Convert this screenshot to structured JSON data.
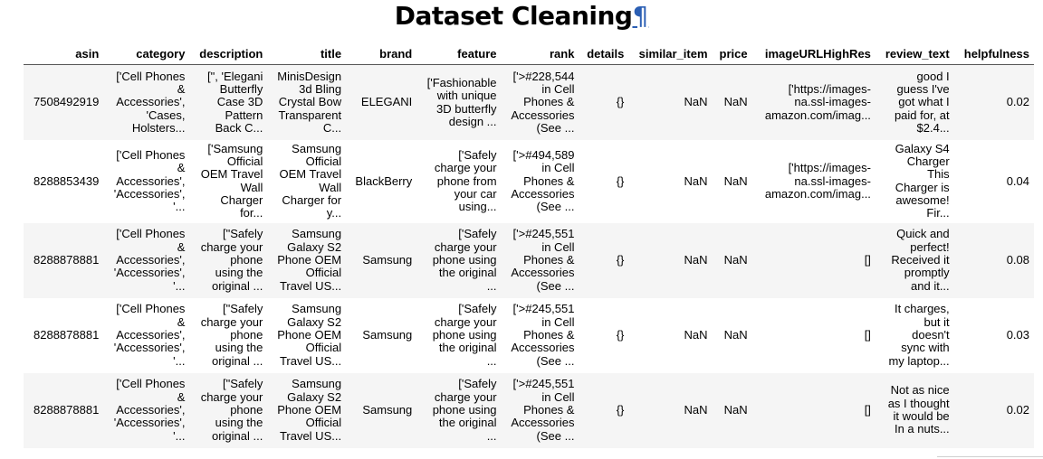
{
  "heading": {
    "title": "Dataset Cleaning",
    "pilcrow": "¶"
  },
  "table": {
    "columns": [
      "asin",
      "category",
      "description",
      "title",
      "brand",
      "feature",
      "rank",
      "details",
      "similar_item",
      "price",
      "imageURLHighRes",
      "review_text",
      "helpfulness"
    ],
    "rows": [
      {
        "asin": "7508492919",
        "category": [
          "['Cell Phones",
          "&",
          "Accessories',",
          "'Cases,",
          "Holsters..."
        ],
        "description": [
          "[\", 'Elegani",
          "Butterfly",
          "Case 3D",
          "Pattern",
          "Back C..."
        ],
        "title": [
          "MinisDesign",
          "3d Bling",
          "Crystal Bow",
          "Transparent",
          "C..."
        ],
        "brand": [
          "ELEGANI"
        ],
        "feature": [
          "['Fashionable",
          "with unique",
          "3D butterfly",
          "design ..."
        ],
        "rank": [
          "['>#228,544",
          "in Cell",
          "Phones &",
          "Accessories",
          "(See ..."
        ],
        "details": [
          "{}"
        ],
        "similar_item": [
          "NaN"
        ],
        "price": [
          "NaN"
        ],
        "imageURLHighRes": [
          "['https://images-",
          "na.ssl-images-",
          "amazon.com/imag..."
        ],
        "review_text": [
          "good I",
          "guess I've",
          "got what I",
          "paid for, at",
          "$2.4..."
        ],
        "helpfulness": [
          "0.02"
        ]
      },
      {
        "asin": "8288853439",
        "category": [
          "['Cell Phones",
          "&",
          "Accessories',",
          "'Accessories',",
          "'..."
        ],
        "description": [
          "['Samsung",
          "Official",
          "OEM Travel",
          "Wall",
          "Charger",
          "for..."
        ],
        "title": [
          "Samsung",
          "Official",
          "OEM Travel",
          "Wall",
          "Charger for",
          "y..."
        ],
        "brand": [
          "BlackBerry"
        ],
        "feature": [
          "['Safely",
          "charge your",
          "phone from",
          "your car",
          "using..."
        ],
        "rank": [
          "['>#494,589",
          "in Cell",
          "Phones &",
          "Accessories",
          "(See ..."
        ],
        "details": [
          "{}"
        ],
        "similar_item": [
          "NaN"
        ],
        "price": [
          "NaN"
        ],
        "imageURLHighRes": [
          "['https://images-",
          "na.ssl-images-",
          "amazon.com/imag..."
        ],
        "review_text": [
          "Galaxy S4",
          "Charger",
          "This",
          "Charger is",
          "awesome!",
          "Fir..."
        ],
        "helpfulness": [
          "0.04"
        ]
      },
      {
        "asin": "8288878881",
        "category": [
          "['Cell Phones",
          "&",
          "Accessories',",
          "'Accessories',",
          "'..."
        ],
        "description": [
          "[\"Safely",
          "charge your",
          "phone",
          "using the",
          "original ..."
        ],
        "title": [
          "Samsung",
          "Galaxy S2",
          "Phone OEM",
          "Official",
          "Travel US..."
        ],
        "brand": [
          "Samsung"
        ],
        "feature": [
          "['Safely",
          "charge your",
          "phone using",
          "the original",
          "..."
        ],
        "rank": [
          "['>#245,551",
          "in Cell",
          "Phones &",
          "Accessories",
          "(See ..."
        ],
        "details": [
          "{}"
        ],
        "similar_item": [
          "NaN"
        ],
        "price": [
          "NaN"
        ],
        "imageURLHighRes": [
          "[]"
        ],
        "review_text": [
          "Quick and",
          "perfect!",
          "Received it",
          "promptly",
          "and it..."
        ],
        "helpfulness": [
          "0.08"
        ]
      },
      {
        "asin": "8288878881",
        "category": [
          "['Cell Phones",
          "&",
          "Accessories',",
          "'Accessories',",
          "'..."
        ],
        "description": [
          "[\"Safely",
          "charge your",
          "phone",
          "using the",
          "original ..."
        ],
        "title": [
          "Samsung",
          "Galaxy S2",
          "Phone OEM",
          "Official",
          "Travel US..."
        ],
        "brand": [
          "Samsung"
        ],
        "feature": [
          "['Safely",
          "charge your",
          "phone using",
          "the original",
          "..."
        ],
        "rank": [
          "['>#245,551",
          "in Cell",
          "Phones &",
          "Accessories",
          "(See ..."
        ],
        "details": [
          "{}"
        ],
        "similar_item": [
          "NaN"
        ],
        "price": [
          "NaN"
        ],
        "imageURLHighRes": [
          "[]"
        ],
        "review_text": [
          "It charges,",
          "but it",
          "doesn't",
          "sync with",
          "my laptop..."
        ],
        "helpfulness": [
          "0.03"
        ]
      },
      {
        "asin": "8288878881",
        "category": [
          "['Cell Phones",
          "&",
          "Accessories',",
          "'Accessories',",
          "'..."
        ],
        "description": [
          "[\"Safely",
          "charge your",
          "phone",
          "using the",
          "original ..."
        ],
        "title": [
          "Samsung",
          "Galaxy S2",
          "Phone OEM",
          "Official",
          "Travel US..."
        ],
        "brand": [
          "Samsung"
        ],
        "feature": [
          "['Safely",
          "charge your",
          "phone using",
          "the original",
          "..."
        ],
        "rank": [
          "['>#245,551",
          "in Cell",
          "Phones &",
          "Accessories",
          "(See ..."
        ],
        "details": [
          "{}"
        ],
        "similar_item": [
          "NaN"
        ],
        "price": [
          "NaN"
        ],
        "imageURLHighRes": [
          "[]"
        ],
        "review_text": [
          "Not as nice",
          "as I thought",
          "it would be",
          "In a nuts..."
        ],
        "helpfulness": [
          "0.02"
        ]
      }
    ]
  }
}
